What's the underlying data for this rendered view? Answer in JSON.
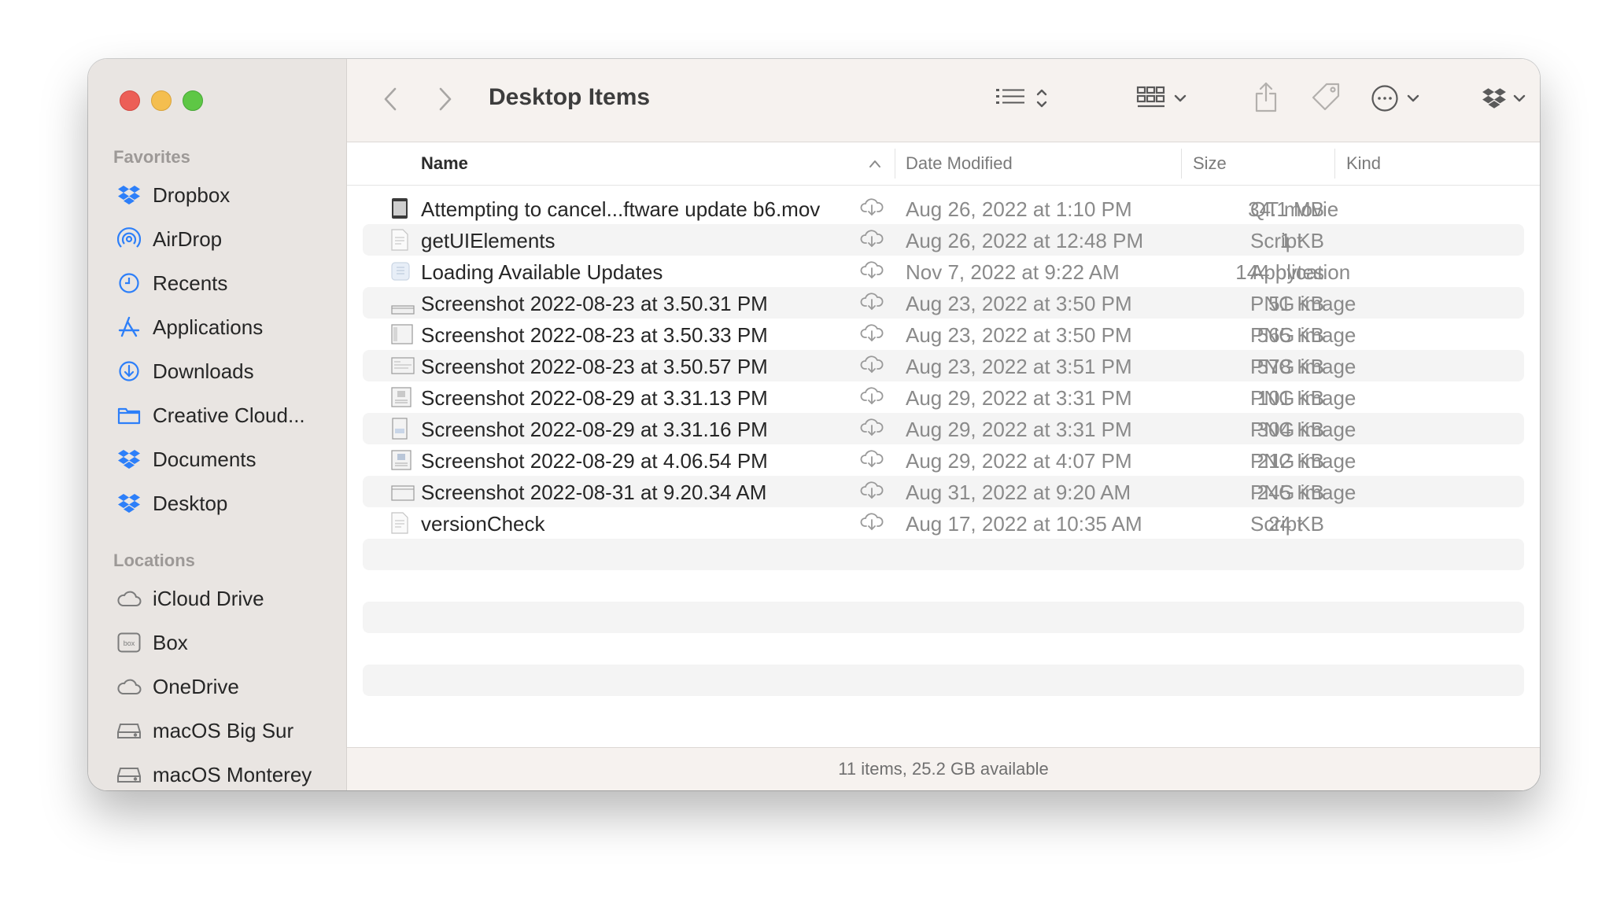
{
  "window": {
    "title": "Desktop Items"
  },
  "sidebar": {
    "favorites_title": "Favorites",
    "favorites": [
      {
        "label": "Dropbox",
        "icon": "dropbox-icon"
      },
      {
        "label": "AirDrop",
        "icon": "airdrop-icon"
      },
      {
        "label": "Recents",
        "icon": "clock-icon"
      },
      {
        "label": "Applications",
        "icon": "applications-icon"
      },
      {
        "label": "Downloads",
        "icon": "download-icon"
      },
      {
        "label": "Creative Cloud...",
        "icon": "folder-icon"
      },
      {
        "label": "Documents",
        "icon": "dropbox-icon"
      },
      {
        "label": "Desktop",
        "icon": "dropbox-icon"
      }
    ],
    "locations_title": "Locations",
    "locations": [
      {
        "label": "iCloud Drive",
        "icon": "cloud-icon"
      },
      {
        "label": "Box",
        "icon": "box-icon"
      },
      {
        "label": "OneDrive",
        "icon": "cloud-icon"
      },
      {
        "label": "macOS Big Sur",
        "icon": "disk-icon"
      },
      {
        "label": "macOS Monterey",
        "icon": "disk-icon"
      }
    ]
  },
  "columns": {
    "name": "Name",
    "date": "Date Modified",
    "size": "Size",
    "kind": "Kind"
  },
  "files": [
    {
      "name": "Attempting to cancel...ftware update b6.mov",
      "date": "Aug 26, 2022 at 1:10 PM",
      "size": "34.1 MB",
      "kind": "QT movie",
      "icon": "movie-file-icon"
    },
    {
      "name": "getUIElements",
      "date": "Aug 26, 2022 at 12:48 PM",
      "size": "1 KB",
      "kind": "Script",
      "icon": "script-file-icon"
    },
    {
      "name": "Loading Available Updates",
      "date": "Nov 7, 2022 at 9:22 AM",
      "size": "144 bytes",
      "kind": "Application",
      "icon": "application-file-icon"
    },
    {
      "name": "Screenshot 2022-08-23 at 3.50.31 PM",
      "date": "Aug 23, 2022 at 3:50 PM",
      "size": "51 KB",
      "kind": "PNG image",
      "icon": "image-file-icon"
    },
    {
      "name": "Screenshot 2022-08-23 at 3.50.33 PM",
      "date": "Aug 23, 2022 at 3:50 PM",
      "size": "565 KB",
      "kind": "PNG image",
      "icon": "image-file-icon"
    },
    {
      "name": "Screenshot 2022-08-23 at 3.50.57 PM",
      "date": "Aug 23, 2022 at 3:51 PM",
      "size": "578 KB",
      "kind": "PNG image",
      "icon": "image-file-icon"
    },
    {
      "name": "Screenshot 2022-08-29 at 3.31.13 PM",
      "date": "Aug 29, 2022 at 3:31 PM",
      "size": "101 KB",
      "kind": "PNG image",
      "icon": "image-file-icon"
    },
    {
      "name": "Screenshot 2022-08-29 at 3.31.16 PM",
      "date": "Aug 29, 2022 at 3:31 PM",
      "size": "304 KB",
      "kind": "PNG image",
      "icon": "image-file-icon"
    },
    {
      "name": "Screenshot 2022-08-29 at 4.06.54 PM",
      "date": "Aug 29, 2022 at 4:07 PM",
      "size": "212 KB",
      "kind": "PNG image",
      "icon": "image-file-icon"
    },
    {
      "name": "Screenshot 2022-08-31 at 9.20.34 AM",
      "date": "Aug 31, 2022 at 9:20 AM",
      "size": "245 KB",
      "kind": "PNG image",
      "icon": "image-file-icon"
    },
    {
      "name": "versionCheck",
      "date": "Aug 17, 2022 at 10:35 AM",
      "size": "24 KB",
      "kind": "Script",
      "icon": "script-file-icon"
    }
  ],
  "status": "11 items, 25.2 GB available",
  "colors": {
    "sidebar_bg": "#e9e5e2",
    "toolbar_bg": "#f6f2ef",
    "accent": "#2d7ff9",
    "stripe": "#f4f4f4"
  }
}
